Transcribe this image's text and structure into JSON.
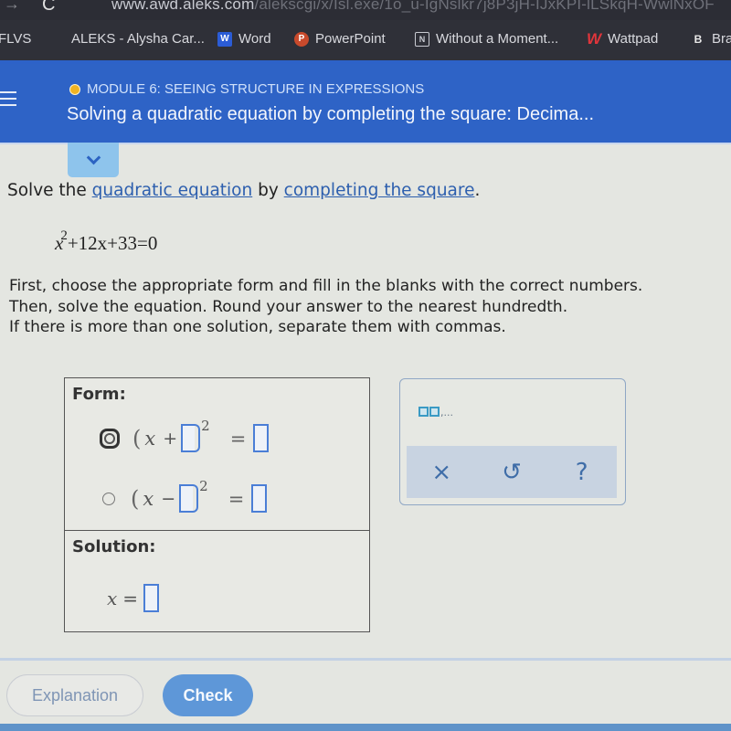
{
  "browser": {
    "url_visible": "www.awd.aleks.com",
    "url_rest": "/alekscgi/x/Isl.exe/1o_u-IgNslkr7j8P3jH-IJxKPI-lLSkqH-WwlNxOF",
    "bookmarks": [
      {
        "label": "FLVS",
        "icon": ""
      },
      {
        "label": "ALEKS - Alysha Car...",
        "icon": ""
      },
      {
        "label": "Word",
        "icon": "word-icon",
        "glyph": "W"
      },
      {
        "label": "PowerPoint",
        "icon": "powerpoint-icon",
        "glyph": "P"
      },
      {
        "label": "Without a Moment...",
        "icon": "document-icon",
        "glyph": "N"
      },
      {
        "label": "Wattpad",
        "icon": "wattpad-icon",
        "glyph": "W"
      },
      {
        "label": "Bra",
        "icon": "brainly-icon",
        "glyph": "B"
      }
    ]
  },
  "header": {
    "module": "MODULE 6: SEEING STRUCTURE IN EXPRESSIONS",
    "module_status_color": "#f0b323",
    "title": "Solving a quadratic equation by completing the square: Decima..."
  },
  "problem": {
    "prompt_prefix": "Solve the ",
    "link1": "quadratic equation",
    "prompt_middle": " by ",
    "link2": "completing the square",
    "prompt_suffix": ".",
    "equation": {
      "base": "x",
      "exponent": "2",
      "rest": "+12x+33=0"
    },
    "instructions": [
      "First, choose the appropriate form and fill in the blanks with the correct numbers.",
      "Then, solve the equation. Round your answer to the nearest hundredth.",
      "If there is more than one solution, separate them with commas."
    ]
  },
  "form_panel": {
    "form_label": "Form:",
    "options": [
      {
        "open_paren": "(",
        "var": "x",
        "op": "+",
        "exponent": "2",
        "equals": "=",
        "selected": true,
        "left_value": "",
        "right_value": ""
      },
      {
        "open_paren": "(",
        "var": "x",
        "op": "−",
        "exponent": "2",
        "equals": "=",
        "selected": false,
        "left_value": "",
        "right_value": ""
      }
    ],
    "solution_label": "Solution:",
    "solution": {
      "var": "x",
      "equals": "=",
      "value": ""
    }
  },
  "keypad": {
    "multi_answer_hint": ",...",
    "buttons": [
      {
        "name": "clear",
        "glyph": "×"
      },
      {
        "name": "undo",
        "glyph": "↺"
      },
      {
        "name": "help",
        "glyph": "?"
      }
    ]
  },
  "footer": {
    "explanation_label": "Explanation",
    "check_label": "Check"
  },
  "colors": {
    "header_blue": "#2e63c6",
    "link_blue": "#2d5fae",
    "check_button": "#5e97d8",
    "input_border": "#4a7ed6"
  }
}
